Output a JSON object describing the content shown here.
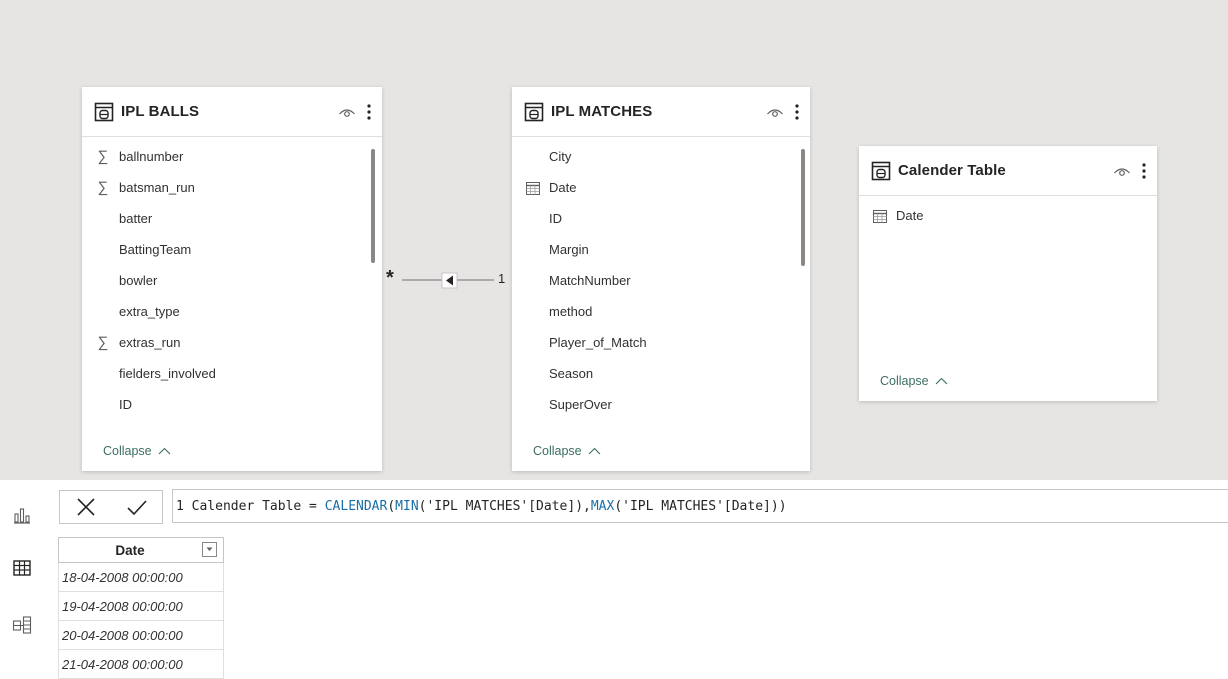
{
  "tables": [
    {
      "title": "IPL BALLS",
      "fields": [
        {
          "label": "ballnumber",
          "icon": "sigma-icon"
        },
        {
          "label": "batsman_run",
          "icon": "sigma-icon"
        },
        {
          "label": "batter",
          "icon": ""
        },
        {
          "label": "BattingTeam",
          "icon": ""
        },
        {
          "label": "bowler",
          "icon": ""
        },
        {
          "label": "extra_type",
          "icon": ""
        },
        {
          "label": "extras_run",
          "icon": "sigma-icon"
        },
        {
          "label": "fielders_involved",
          "icon": ""
        },
        {
          "label": "ID",
          "icon": ""
        }
      ],
      "collapse_label": "Collapse"
    },
    {
      "title": "IPL MATCHES",
      "fields": [
        {
          "label": "City",
          "icon": ""
        },
        {
          "label": "Date",
          "icon": "calendar-icon"
        },
        {
          "label": "ID",
          "icon": ""
        },
        {
          "label": "Margin",
          "icon": ""
        },
        {
          "label": "MatchNumber",
          "icon": ""
        },
        {
          "label": "method",
          "icon": ""
        },
        {
          "label": "Player_of_Match",
          "icon": ""
        },
        {
          "label": "Season",
          "icon": ""
        },
        {
          "label": "SuperOver",
          "icon": ""
        }
      ],
      "collapse_label": "Collapse"
    },
    {
      "title": "Calender Table",
      "fields": [
        {
          "label": "Date",
          "icon": "calendar-icon"
        }
      ],
      "collapse_label": "Collapse"
    }
  ],
  "relationship": {
    "many_label": "*",
    "one_label": "1"
  },
  "formula": {
    "line_number": "1",
    "prefix": "Calender Table = ",
    "fn1": "CALENDAR",
    "open": "(",
    "fn2": "MIN",
    "arg1": "('IPL MATCHES'[Date]),",
    "fn3": "MAX",
    "arg2": "('IPL MATCHES'[Date]))"
  },
  "grid": {
    "column": "Date",
    "rows": [
      "18-04-2008 00:00:00",
      "19-04-2008 00:00:00",
      "20-04-2008 00:00:00",
      "21-04-2008 00:00:00"
    ]
  },
  "colors": {
    "canvas": "#e6e5e4",
    "link": "#3b6e62",
    "dax_function": "#1a6ea5"
  }
}
